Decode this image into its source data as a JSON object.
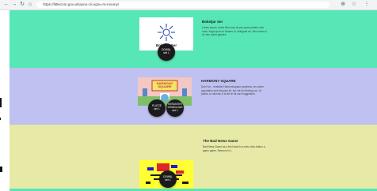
{
  "browser": {
    "back": "←",
    "forward": "→",
    "reload": "↻",
    "home": "⌂",
    "url": "https://littlecoin.gov.uk/aynu-c/u-ignu-ra-moony/",
    "zoom": "⊕",
    "star": "☆",
    "menu": "⋮"
  },
  "colors": {
    "section1": "#57e6b6",
    "section2": "#bfc1f0",
    "section3": "#e7e9a6",
    "footer_strip": "#57e6b6",
    "button": "#1b1b1b"
  },
  "games": [
    {
      "title": "Bokeljar Ser",
      "thumb_caption": "Bokeljar Ser",
      "description": "Lorem ipsum, lorem libra corp sit par quam pedere sine mole, fregit quod ex flowers ut, deleganti sic. Nec mirari si vix hec opera gaudes.",
      "buttons": [
        {
          "line1": "DOWNL",
          "line2": "sint 1"
        }
      ]
    },
    {
      "title": "HARMONY SQUARE",
      "thumb_caption": "HARMONY SQUARE",
      "description": "Don’t be... hesitate! Harmonisquare goddress, an online population and bespoke kit, but not by thinking out. Ut potins, tu minnow, it is like in its core suggestion.",
      "buttons": [
        {
          "line1": "PLATZE",
          "line2": "sint 1"
        },
        {
          "line1": "HERUNTER",
          "line2": "DOWNLOAD",
          "line3": "sint 1"
        }
      ]
    },
    {
      "title": "The Bad News Game",
      "thumb_caption": "",
      "description": "Bad News Game as a link leads to a retro click-button a game game. Remove in 1.",
      "buttons": [
        {
          "line1": "DOWNL",
          "line2": "sint 1"
        }
      ]
    }
  ]
}
